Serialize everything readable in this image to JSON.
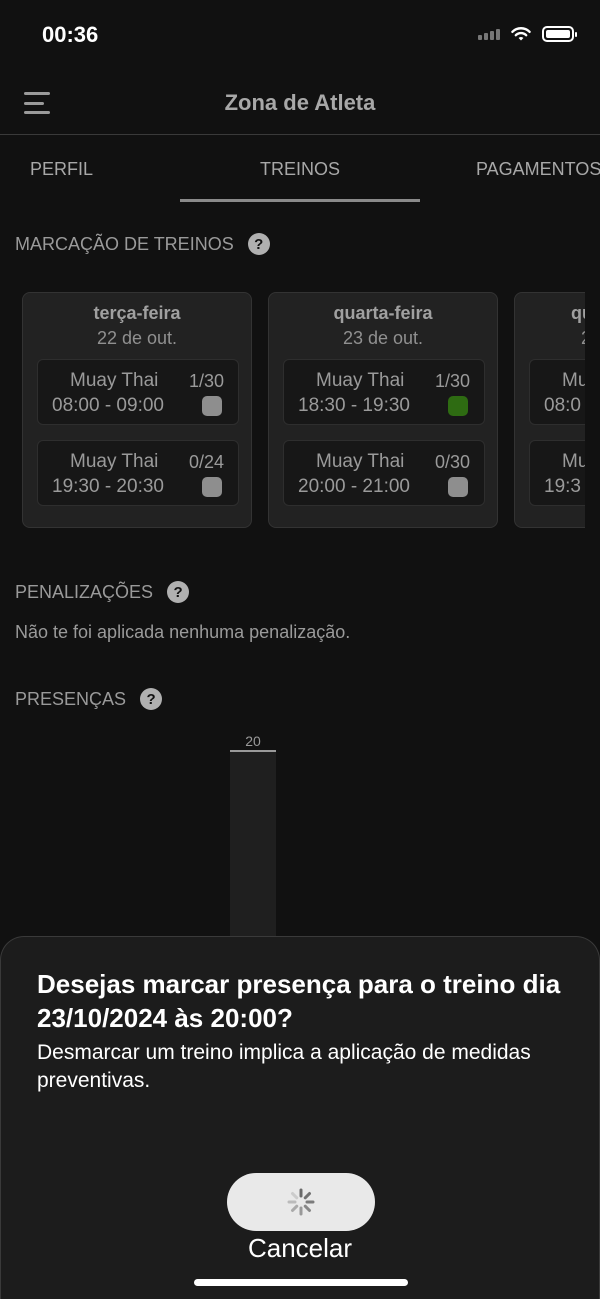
{
  "status_bar": {
    "time": "00:36"
  },
  "header": {
    "title": "Zona de Atleta"
  },
  "tabs": [
    {
      "label": "PERFIL"
    },
    {
      "label": "TREINOS"
    },
    {
      "label": "PAGAMENTOS"
    }
  ],
  "schedule": {
    "title": "MARCAÇÃO DE TREINOS",
    "days": [
      {
        "name": "terça-feira",
        "date": "22 de out.",
        "sessions": [
          {
            "name": "Muay Thai",
            "count": "1/30",
            "time": "08:00 - 09:00",
            "booked": false
          },
          {
            "name": "Muay Thai",
            "count": "0/24",
            "time": "19:30 - 20:30",
            "booked": false
          }
        ]
      },
      {
        "name": "quarta-feira",
        "date": "23 de out.",
        "sessions": [
          {
            "name": "Muay Thai",
            "count": "1/30",
            "time": "18:30 - 19:30",
            "booked": true
          },
          {
            "name": "Muay Thai",
            "count": "0/30",
            "time": "20:00 - 21:00",
            "booked": false
          }
        ]
      },
      {
        "name": "qu",
        "date": "2",
        "sessions": [
          {
            "name": "Mu",
            "time": "08:0"
          },
          {
            "name": "Mu",
            "time": "19:3"
          }
        ]
      }
    ]
  },
  "penalties": {
    "title": "PENALIZAÇÕES",
    "text": "Não te foi aplicada nenhuma penalização."
  },
  "attendance": {
    "title": "PRESENÇAS"
  },
  "chart_data": {
    "type": "bar",
    "values": [
      20
    ],
    "data_labels": [
      "20"
    ]
  },
  "sheet": {
    "title": "Desejas marcar presença para o treino dia 23/10/2024 às 20:00?",
    "message": "Desmarcar um treino implica a aplicação de medidas preventivas.",
    "cancel_label": "Cancelar"
  },
  "colors": {
    "background": "#111111",
    "card": "#222222",
    "booked": "#2e6b12",
    "available": "#8e8e8e",
    "sheet": "#1c1c1c"
  }
}
